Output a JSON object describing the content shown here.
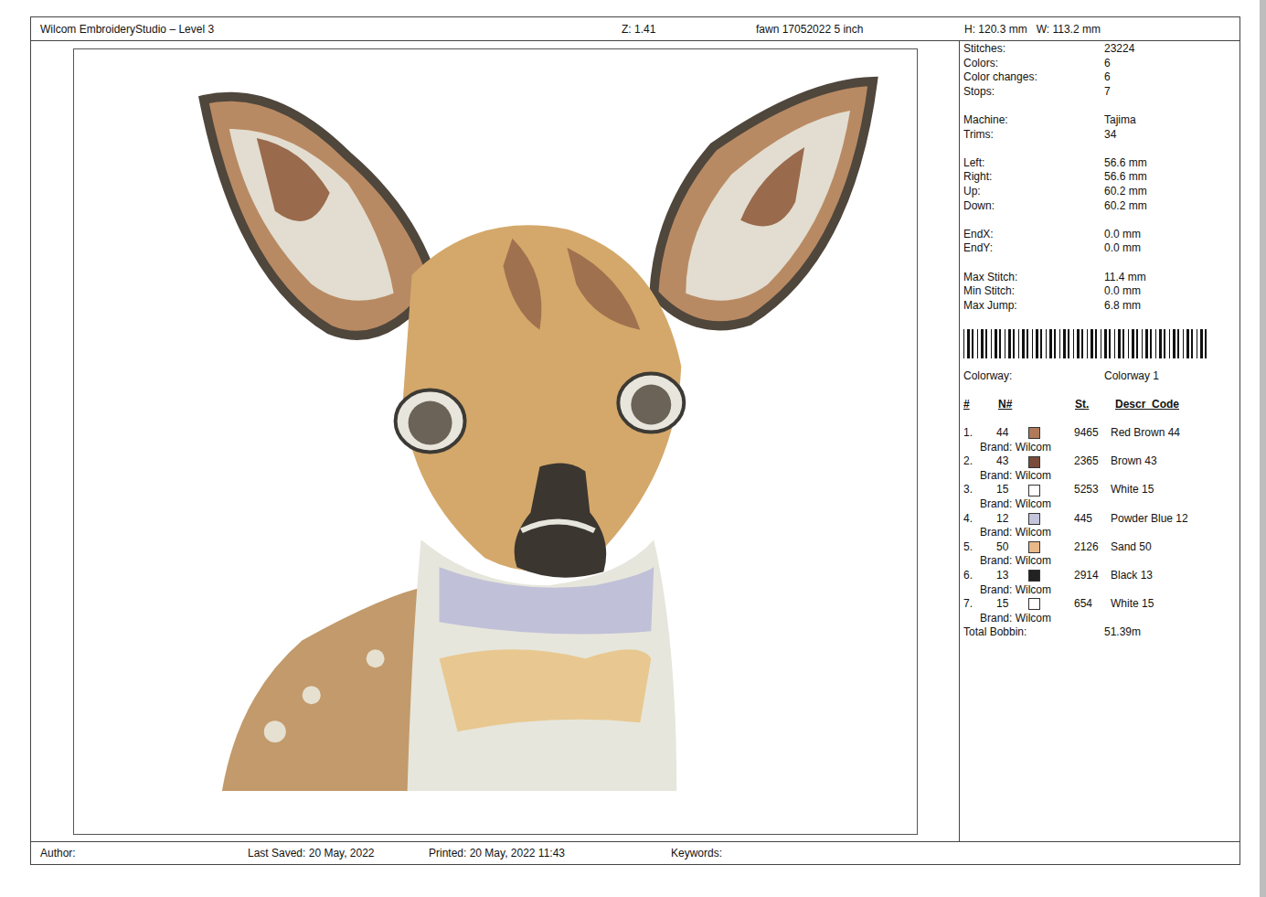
{
  "header": {
    "app": "Wilcom EmbroideryStudio – Level 3",
    "zoom": "Z: 1.41",
    "file": "fawn 17052022 5 inch",
    "height": "H: 120.3 mm",
    "width": "W: 113.2 mm"
  },
  "stats": [
    [
      {
        "label": "Stitches:",
        "value": "23224"
      },
      {
        "label": "Colors:",
        "value": "6"
      },
      {
        "label": "Color changes:",
        "value": "6"
      },
      {
        "label": "Stops:",
        "value": "7"
      }
    ],
    [
      {
        "label": "Machine:",
        "value": "Tajima"
      },
      {
        "label": "Trims:",
        "value": "34"
      }
    ],
    [
      {
        "label": "Left:",
        "value": "56.6 mm"
      },
      {
        "label": "Right:",
        "value": "56.6 mm"
      },
      {
        "label": "Up:",
        "value": "60.2 mm"
      },
      {
        "label": "Down:",
        "value": "60.2 mm"
      }
    ],
    [
      {
        "label": "EndX:",
        "value": "0.0 mm"
      },
      {
        "label": "EndY:",
        "value": "0.0 mm"
      }
    ],
    [
      {
        "label": "Max Stitch:",
        "value": "11.4 mm"
      },
      {
        "label": "Min Stitch:",
        "value": "0.0 mm"
      },
      {
        "label": "Max Jump:",
        "value": "6.8 mm"
      }
    ]
  ],
  "colorway": {
    "label": "Colorway:",
    "value": "Colorway 1"
  },
  "color_table": {
    "columns": [
      "#",
      "N#",
      "St.",
      "Descr_Code"
    ],
    "rows": [
      {
        "index": "1.",
        "number": "44",
        "color": "#b07a5a",
        "stitches": "9465",
        "descr": "Red Brown 44",
        "brand": "Brand: Wilcom"
      },
      {
        "index": "2.",
        "number": "43",
        "color": "#7a4a3a",
        "stitches": "2365",
        "descr": "Brown 43",
        "brand": "Brand: Wilcom"
      },
      {
        "index": "3.",
        "number": "15",
        "color": "#ffffff",
        "stitches": "5253",
        "descr": "White 15",
        "brand": "Brand: Wilcom"
      },
      {
        "index": "4.",
        "number": "12",
        "color": "#c4c4dc",
        "stitches": "445",
        "descr": "Powder Blue 12",
        "brand": "Brand: Wilcom"
      },
      {
        "index": "5.",
        "number": "50",
        "color": "#e8b888",
        "stitches": "2126",
        "descr": "Sand 50",
        "brand": "Brand: Wilcom"
      },
      {
        "index": "6.",
        "number": "13",
        "color": "#222222",
        "stitches": "2914",
        "descr": "Black 13",
        "brand": "Brand: Wilcom"
      },
      {
        "index": "7.",
        "number": "15",
        "color": "#ffffff",
        "stitches": "654",
        "descr": "White 15",
        "brand": "Brand: Wilcom"
      }
    ]
  },
  "total": {
    "label": "Total Bobbin:",
    "value": "51.39m"
  },
  "footer": {
    "author": "Author:",
    "saved": "Last Saved: 20 May, 2022",
    "printed": "Printed: 20 May, 2022 11:43",
    "keywords": "Keywords:"
  }
}
